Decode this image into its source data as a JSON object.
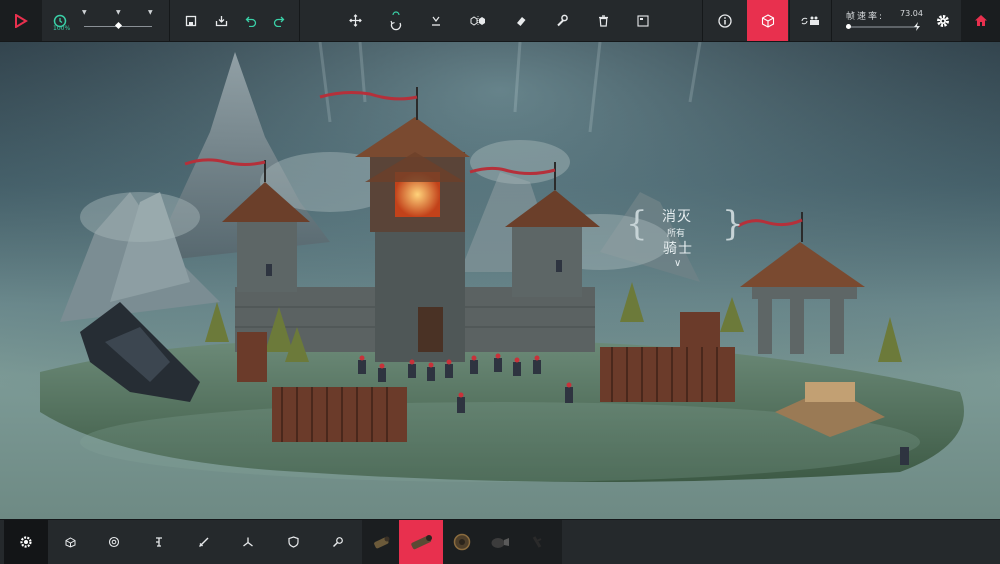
{
  "toolbar": {
    "time_scale_label": "100%",
    "fps_label": "帧速率:",
    "fps_value": "73.04",
    "icons": [
      "play-icon",
      "clock-icon",
      "save-icon",
      "load-icon",
      "undo-icon",
      "redo-icon",
      "move-icon",
      "rotate-icon",
      "snap-icon",
      "mirror-icon",
      "eraser-icon",
      "wrench-icon",
      "trash-icon",
      "window-icon",
      "info-icon",
      "cube-icon",
      "camera-icon",
      "settings-icon",
      "home-icon"
    ]
  },
  "objective": {
    "line1": "消灭",
    "line2": "所有",
    "line3": "骑士"
  },
  "block_bar": {
    "categories": [
      "basic-category",
      "block-category",
      "wheel-category",
      "mechanical-category",
      "weapons-category",
      "flight-category",
      "armour-category",
      "utility-category"
    ],
    "active_category": "basic-category",
    "blocks": [
      "barrel-block",
      "cannon-block",
      "wheel-block",
      "grabber-block",
      "spike-block"
    ],
    "selected_block": "cannon-block"
  },
  "colors": {
    "accent_red": "#e8304e",
    "teal": "#3ad1a8",
    "bar_bg": "#25292c"
  }
}
